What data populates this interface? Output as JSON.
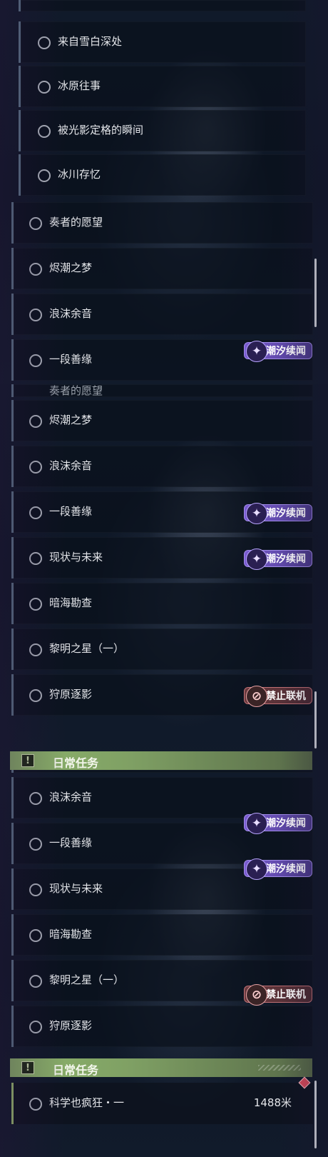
{
  "panel1": {
    "sub_items": [
      "来自雪白深处",
      "冰原往事",
      "被光影定格的瞬间",
      "冰川存忆"
    ],
    "main_items": [
      "奏者的愿望",
      "烬潮之梦",
      "浪沫余音",
      "一段善缘"
    ],
    "badge": "潮汐续闻"
  },
  "panel2": {
    "partial_top": "奏者的愿望",
    "items": [
      "烬潮之梦",
      "浪沫余音",
      "一段善缘",
      "现状与未来",
      "暗海勘查",
      "黎明之星（一）",
      "狩原逐影"
    ],
    "badges": [
      "潮汐续闻",
      "潮汐续闻",
      "禁止联机"
    ],
    "partial_header": "日常任务"
  },
  "panel3": {
    "items": [
      "浪沫余音",
      "一段善缘",
      "现状与未来",
      "暗海勘查",
      "黎明之星（一）",
      "狩原逐影"
    ],
    "badges": [
      "潮汐续闻",
      "潮汐续闻",
      "禁止联机"
    ],
    "daily_header": "日常任务",
    "daily_item": {
      "label": "科学也疯狂・一",
      "distance": "1488米"
    }
  },
  "icons": {
    "tidal": "feather-spiral-icon",
    "no_multiplayer": "globe-forbidden-icon",
    "daily": "exclamation-icon"
  },
  "colors": {
    "tidal_badge": "#7a5bd0",
    "no_multi_badge": "#6a3a3e",
    "daily_header": "#8db36b",
    "track_marker": "#d74a5a"
  }
}
